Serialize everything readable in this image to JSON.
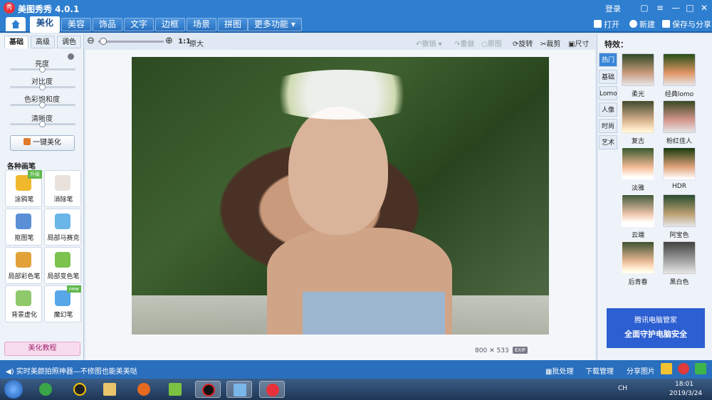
{
  "titlebar": {
    "app_title": "美图秀秀 4.0.1",
    "logo_text": "秀",
    "login": "登录",
    "btn_msg": "▢",
    "btn_menu": "≡",
    "btn_min": "—",
    "btn_max": "□",
    "btn_close": "✕"
  },
  "menu": {
    "tabs": [
      "美化",
      "美容",
      "饰品",
      "文字",
      "边框",
      "场景",
      "拼图",
      "更多功能 ▾"
    ],
    "open": "打开",
    "new": "新建",
    "save_share": "保存与分享"
  },
  "left_panel": {
    "subtabs": [
      "基础",
      "高级",
      "调色"
    ],
    "sliders": [
      {
        "label": "亮度",
        "value": 0.5
      },
      {
        "label": "对比度",
        "value": 0.5
      },
      {
        "label": "色彩饱和度",
        "value": 0.5
      },
      {
        "label": "清晰度",
        "value": 0.5
      }
    ],
    "oneclick": "一键美化",
    "brush_title": "各种画笔",
    "brushes": [
      {
        "label": "涂鸦笔",
        "badge": "升级"
      },
      {
        "label": "消除笔",
        "badge": ""
      },
      {
        "label": "抠图笔",
        "badge": ""
      },
      {
        "label": "局部马赛克",
        "badge": ""
      },
      {
        "label": "局部彩色笔",
        "badge": ""
      },
      {
        "label": "局部变色笔",
        "badge": ""
      },
      {
        "label": "背景虚化",
        "badge": ""
      },
      {
        "label": "魔幻笔",
        "badge": "new"
      }
    ],
    "tutorial": "美化教程"
  },
  "toolbar": {
    "ratio": "1:1",
    "original": "原大",
    "undo": "撤销",
    "redo": "重做",
    "restore": "原图",
    "rotate": "旋转",
    "crop": "裁剪",
    "size": "尺寸"
  },
  "canvas": {
    "image_w": "800",
    "times": "✕",
    "image_h": "533",
    "exif": "EXIF"
  },
  "right_panel": {
    "title": "特效：",
    "categories": [
      "热门",
      "基础",
      "Lomo",
      "人像",
      "时尚",
      "艺术"
    ],
    "effects": [
      "柔光",
      "经典lomo",
      "复古",
      "粉红佳人",
      "淡雅",
      "HDR",
      "云端",
      "阿宝色",
      "后青春",
      "黑白色"
    ],
    "ad_line1": "腾讯电脑管家",
    "ad_line2": "全面守护电脑安全"
  },
  "statusbar": {
    "text": "实时美颜拍照神器—不修图也能美美哒",
    "batch": "批处理",
    "download": "下载管理",
    "share": "分享图片"
  },
  "taskbar": {
    "time": "18:01",
    "date": "2019/3/24",
    "lang": "CH"
  },
  "colors": {
    "brand": "#2f7fd0",
    "status": "#2a6fbd"
  }
}
